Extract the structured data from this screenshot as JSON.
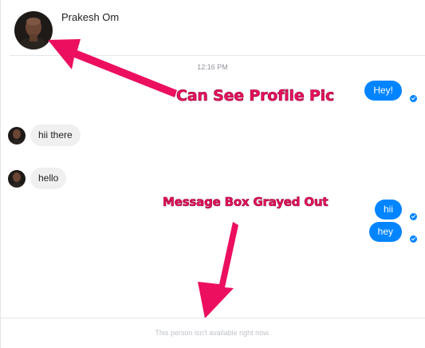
{
  "contact": {
    "name": "Prakesh Om"
  },
  "conversation": {
    "timestamp": "12:16 PM",
    "messages": [
      {
        "direction": "out",
        "text": "Hey!"
      },
      {
        "direction": "in",
        "text": "hii there"
      },
      {
        "direction": "in",
        "text": "hello"
      },
      {
        "direction": "out",
        "text": "hii"
      },
      {
        "direction": "out",
        "text": "hey"
      }
    ]
  },
  "footer": {
    "status": "This person isn't available right now."
  },
  "annotations": {
    "profile_pic": "Can See Profile Pic",
    "message_box": "Message Box Grayed Out"
  },
  "colors": {
    "outgoing_bubble": "#0084ff",
    "incoming_bubble": "#f1f0f0",
    "annotation": "#ec0f5f"
  }
}
